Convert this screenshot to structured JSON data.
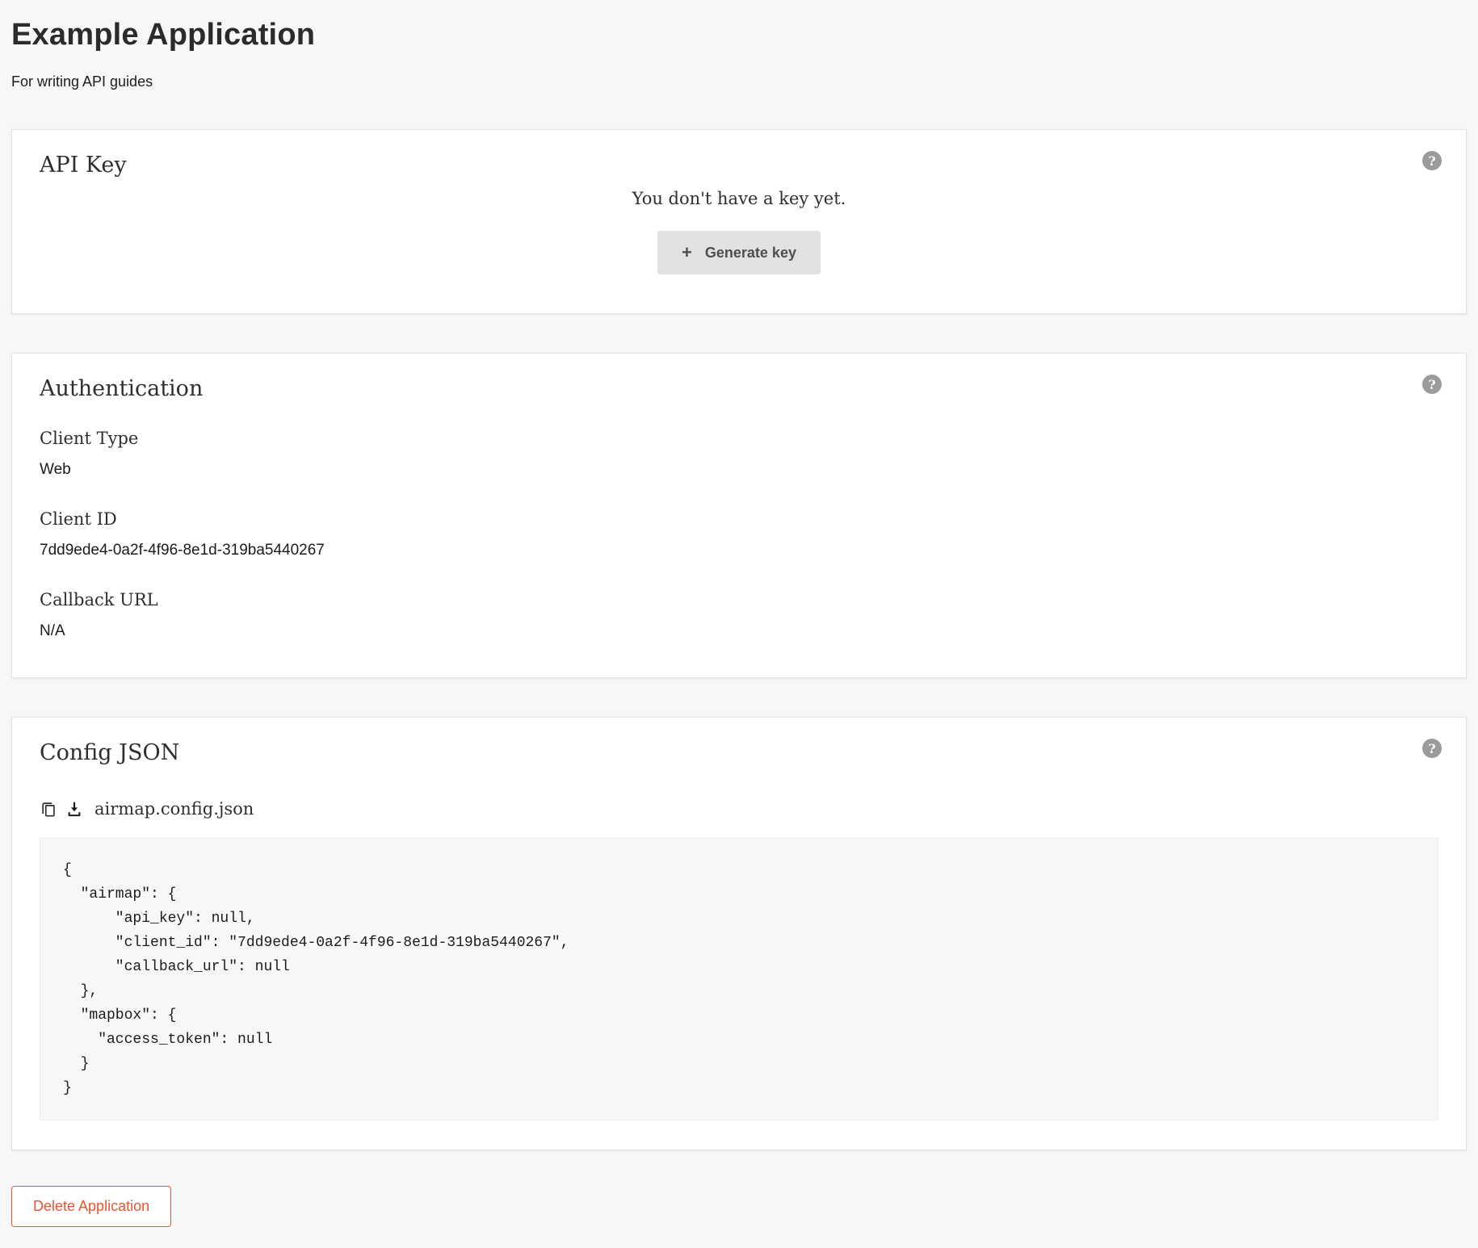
{
  "page": {
    "title": "Example Application",
    "subtitle": "For writing API guides"
  },
  "icons": {
    "help_glyph": "?",
    "plus_glyph": "+"
  },
  "api_key_card": {
    "title": "API Key",
    "empty_message": "You don't have a key yet.",
    "generate_button_label": "Generate key"
  },
  "authentication_card": {
    "title": "Authentication",
    "fields": [
      {
        "label": "Client Type",
        "value": "Web"
      },
      {
        "label": "Client ID",
        "value": "7dd9ede4-0a2f-4f96-8e1d-319ba5440267"
      },
      {
        "label": "Callback URL",
        "value": "N/A"
      }
    ]
  },
  "config_json_card": {
    "title": "Config JSON",
    "filename": "airmap.config.json",
    "code": "{\n  \"airmap\": {\n      \"api_key\": null,\n      \"client_id\": \"7dd9ede4-0a2f-4f96-8e1d-319ba5440267\",\n      \"callback_url\": null\n  },\n  \"mapbox\": {\n    \"access_token\": null\n  }\n}"
  },
  "footer": {
    "delete_button_label": "Delete Application"
  },
  "colors": {
    "page_background": "#f7f7f7",
    "card_background": "#ffffff",
    "accent_orange": "#e8552f",
    "button_gray": "#e2e2e2",
    "help_icon_gray": "#9b9b9b"
  }
}
